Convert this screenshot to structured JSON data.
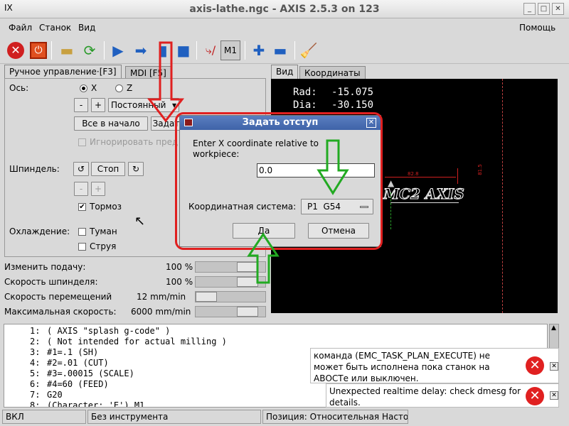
{
  "window": {
    "title": "axis-lathe.ngc - AXIS 2.5.3 on 123"
  },
  "menus": [
    "Файл",
    "Станок",
    "Вид",
    "Помощь"
  ],
  "tabs": {
    "manual": "Ручное управление·[F3]",
    "mdi": "MDI [F5]",
    "view": "Вид",
    "coords": "Координаты"
  },
  "manual": {
    "axis_label": "Ось:",
    "axis_x": "X",
    "axis_z": "Z",
    "minus": "-",
    "plus": "+",
    "jog_mode": "Постоянный",
    "home_all": "Все в начало",
    "touch_off": "Задать",
    "ignore_limits": "Игнорировать пред",
    "spindle_label": "Шпиндель:",
    "spindle_stop": "Стоп",
    "brake": "Тормоз",
    "coolant_label": "Охлаждение:",
    "mist": "Туман",
    "flood": "Струя"
  },
  "overrides": [
    {
      "label": "Изменить подачу:",
      "value": "100 %",
      "fraction": 0.85
    },
    {
      "label": "Скорость шпинделя:",
      "value": "100 %",
      "fraction": 0.85
    },
    {
      "label": "Скорость перемещений",
      "value": "12 mm/min",
      "fraction": 0.0
    },
    {
      "label": "Максимальная скорость:",
      "value": "6000 mm/min",
      "fraction": 0.85
    }
  ],
  "preview": {
    "rad_label": "Rad:",
    "rad_value": "-15.075",
    "dia_label": "Dia:",
    "dia_value": "-30.150",
    "logo_text": "MC2 AXIS",
    "dim1": "82.8",
    "dim2": "81.5"
  },
  "code_lines": [
    {
      "num": "1:",
      "text": "( AXIS \"splash g-code\" )"
    },
    {
      "num": "2:",
      "text": "( Not intended for actual milling )"
    },
    {
      "num": "3:",
      "text": "#1=.1 (SH)"
    },
    {
      "num": "4:",
      "text": "#2=.01 (CUT)"
    },
    {
      "num": "5:",
      "text": "#3=.00015 (SCALE)"
    },
    {
      "num": "6:",
      "text": "#4=60 (FEED)"
    },
    {
      "num": "7:",
      "text": "G20"
    },
    {
      "num": "8:",
      "text": "(Character: 'E') M1"
    }
  ],
  "status": {
    "state": "ВКЛ",
    "tool": "Без инструмента",
    "position": "Позиция: Относительная Насто"
  },
  "dialog": {
    "title": "Задать отступ",
    "prompt": "Enter X coordinate relative to workpiece:",
    "value": "0.0",
    "coord_label": "Координатная система:",
    "coord_value": "P1  G54",
    "ok": "Да",
    "cancel": "Отмена"
  },
  "errors": [
    {
      "text": "команда (EMC_TASK_PLAN_EXECUTE) не может быть исполнена пока станок на АВОСТе или выключен."
    },
    {
      "text": "Unexpected realtime delay: check dmesg for details."
    }
  ],
  "colors": {
    "annotation_red": "#e02020",
    "annotation_green": "#22aa22",
    "dialog_title": "#4a6fb5"
  }
}
